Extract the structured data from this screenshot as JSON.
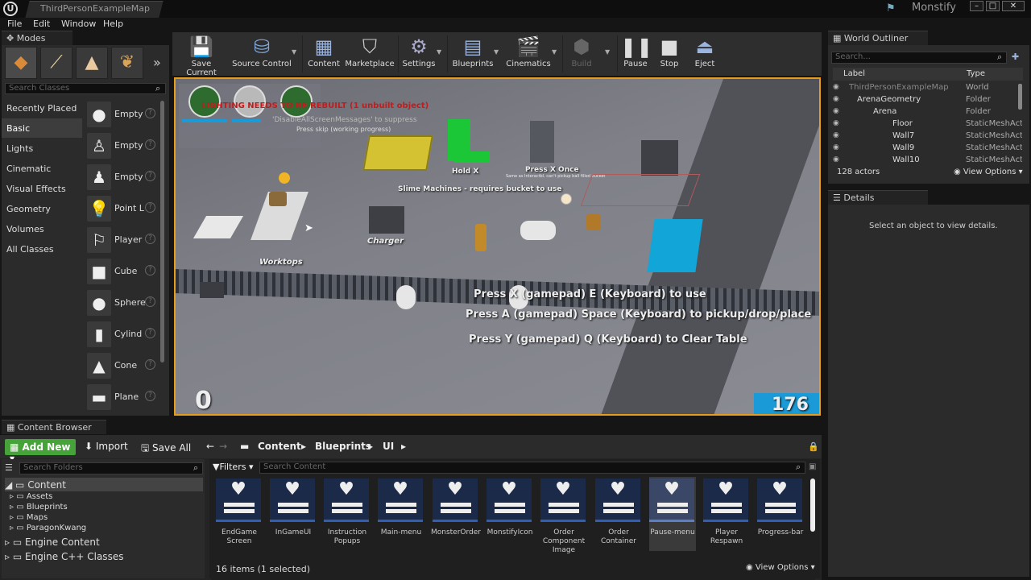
{
  "window": {
    "tab_title": "ThirdPersonExampleMap",
    "brand": "Monstify",
    "btn_min": "–",
    "btn_max": "□",
    "btn_close": "✕"
  },
  "menu": [
    "File",
    "Edit",
    "Window",
    "Help"
  ],
  "modes": {
    "tab": "Modes",
    "search_placeholder": "Search Classes",
    "categories": [
      "Recently Placed",
      "Basic",
      "Lights",
      "Cinematic",
      "Visual Effects",
      "Geometry",
      "Volumes",
      "All Classes"
    ],
    "selected_category": "Basic",
    "items": [
      {
        "label": "Empty",
        "icon": "sphere-icon"
      },
      {
        "label": "Empty",
        "icon": "character-icon"
      },
      {
        "label": "Empty",
        "icon": "pawn-icon"
      },
      {
        "label": "Point L",
        "icon": "lightbulb-icon"
      },
      {
        "label": "Player",
        "icon": "player-start-icon"
      },
      {
        "label": "Cube",
        "icon": "cube-icon"
      },
      {
        "label": "Sphere",
        "icon": "sphere-icon"
      },
      {
        "label": "Cylind",
        "icon": "cylinder-icon"
      },
      {
        "label": "Cone",
        "icon": "cone-icon"
      },
      {
        "label": "Plane",
        "icon": "plane-icon"
      }
    ]
  },
  "toolbar": [
    "Save Current",
    "Source Control",
    "Content",
    "Marketplace",
    "Settings",
    "Blueprints",
    "Cinematics",
    "Build",
    "Pause",
    "Stop",
    "Eject"
  ],
  "viewport": {
    "lighting_warning": "LIGHTING NEEDS TO BE REBUILT (1 unbuilt object)",
    "suppress_hint": "'DisableAllScreenMessages' to suppress",
    "skip_hint": "Press skip (working progress)",
    "labels": {
      "hold_x": "Hold X",
      "press_x_once": "Press X Once",
      "press_x_sub": "Same as Interactbl, can't pickup ball filled bucket",
      "slime": "Slime Machines - requires bucket to use",
      "charger": "Charger",
      "worktops": "Worktops"
    },
    "instructions": [
      "Press X (gamepad) E (Keyboard) to use",
      "Press A (gamepad) Space (Keyboard) to pickup/drop/place",
      "Press Y (gamepad) Q (Keyboard) to Clear Table"
    ],
    "score": "0",
    "timer": "176",
    "timer_color": "#1a9ad6"
  },
  "outliner": {
    "tab": "World Outliner",
    "search_placeholder": "Search...",
    "col_label": "Label",
    "col_type": "Type",
    "rows": [
      {
        "name": "ThirdPersonExampleMap",
        "type": "World"
      },
      {
        "name": "ArenaGeometry",
        "type": "Folder"
      },
      {
        "name": "Arena",
        "type": "Folder"
      },
      {
        "name": "Floor",
        "type": "StaticMeshActor"
      },
      {
        "name": "Wall7",
        "type": "StaticMeshActor"
      },
      {
        "name": "Wall9",
        "type": "StaticMeshActor"
      },
      {
        "name": "Wall10",
        "type": "StaticMeshActor"
      }
    ],
    "actor_count": "128 actors",
    "view_options": "View Options"
  },
  "details": {
    "tab": "Details",
    "empty_message": "Select an object to view details."
  },
  "content_browser": {
    "tab": "Content Browser",
    "add_new": "Add New",
    "import": "Import",
    "save_all": "Save All",
    "breadcrumb": [
      "Content",
      "Blueprints",
      "UI"
    ],
    "search_folders": "Search Folders",
    "search_content": "Search Content",
    "filters": "Filters",
    "folders": [
      {
        "name": "Content",
        "level": 0
      },
      {
        "name": "Assets",
        "level": 1
      },
      {
        "name": "Blueprints",
        "level": 1
      },
      {
        "name": "Maps",
        "level": 1
      },
      {
        "name": "ParagonKwang",
        "level": 1
      },
      {
        "name": "Engine Content",
        "level": 0
      },
      {
        "name": "Engine C++ Classes",
        "level": 0
      }
    ],
    "assets": [
      "EndGame Screen",
      "InGameUI",
      "Instruction Popups",
      "Main-menu",
      "MonsterOrder",
      "MonstifyIcon",
      "Order Component Image",
      "Order Container",
      "Pause-menu",
      "Player Respawn",
      "Progress-bar"
    ],
    "selected_asset": "Pause-menu",
    "status": "16 items (1 selected)",
    "view_options": "View Options"
  },
  "colors": {
    "accent_orange": "#e89c1b",
    "add_new_green": "#46a33a"
  }
}
